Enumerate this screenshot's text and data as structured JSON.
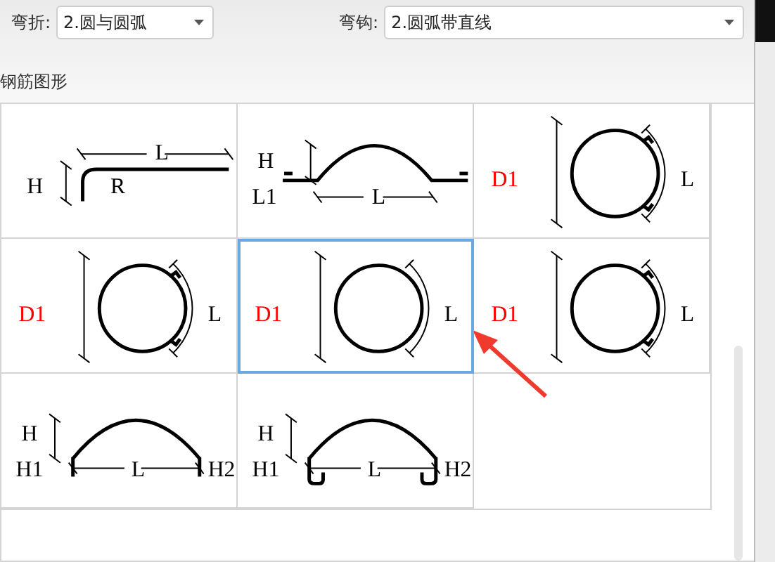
{
  "filters": [
    {
      "label": "弯折:",
      "value": "2.圆与圆弧"
    },
    {
      "label": "弯钩:",
      "value": "2.圆弧带直线"
    }
  ],
  "section_title": "钢筋图形",
  "shapes": [
    {
      "kind": "bend",
      "selected": false,
      "labels": [
        {
          "text": "H",
          "color": "#000000"
        },
        {
          "text": "R",
          "color": "#000000"
        },
        {
          "text": "L",
          "color": "#000000"
        }
      ]
    },
    {
      "kind": "hump",
      "selected": false,
      "labels": [
        {
          "text": "H",
          "color": "#000000"
        },
        {
          "text": "L1",
          "color": "#000000"
        },
        {
          "text": "L",
          "color": "#000000"
        }
      ]
    },
    {
      "kind": "hooked-circle",
      "selected": false,
      "labels": [
        {
          "text": "D1",
          "color": "#ff0000"
        },
        {
          "text": "L",
          "color": "#000000"
        }
      ]
    },
    {
      "kind": "hooked-circle",
      "selected": false,
      "labels": [
        {
          "text": "D1",
          "color": "#ff0000"
        },
        {
          "text": "L",
          "color": "#000000"
        }
      ]
    },
    {
      "kind": "circle",
      "selected": true,
      "labels": [
        {
          "text": "D1",
          "color": "#ff0000"
        },
        {
          "text": "L",
          "color": "#000000"
        }
      ]
    },
    {
      "kind": "hooked-circle",
      "selected": false,
      "labels": [
        {
          "text": "D1",
          "color": "#ff0000"
        },
        {
          "text": "L",
          "color": "#000000"
        }
      ]
    },
    {
      "kind": "arch",
      "selected": false,
      "labels": [
        {
          "text": "H",
          "color": "#000000"
        },
        {
          "text": "H1",
          "color": "#000000"
        },
        {
          "text": "L",
          "color": "#000000"
        },
        {
          "text": "H2",
          "color": "#000000"
        }
      ]
    },
    {
      "kind": "hooked-arch",
      "selected": false,
      "labels": [
        {
          "text": "H",
          "color": "#000000"
        },
        {
          "text": "H1",
          "color": "#000000"
        },
        {
          "text": "L",
          "color": "#000000"
        },
        {
          "text": "H2",
          "color": "#000000"
        }
      ]
    }
  ]
}
